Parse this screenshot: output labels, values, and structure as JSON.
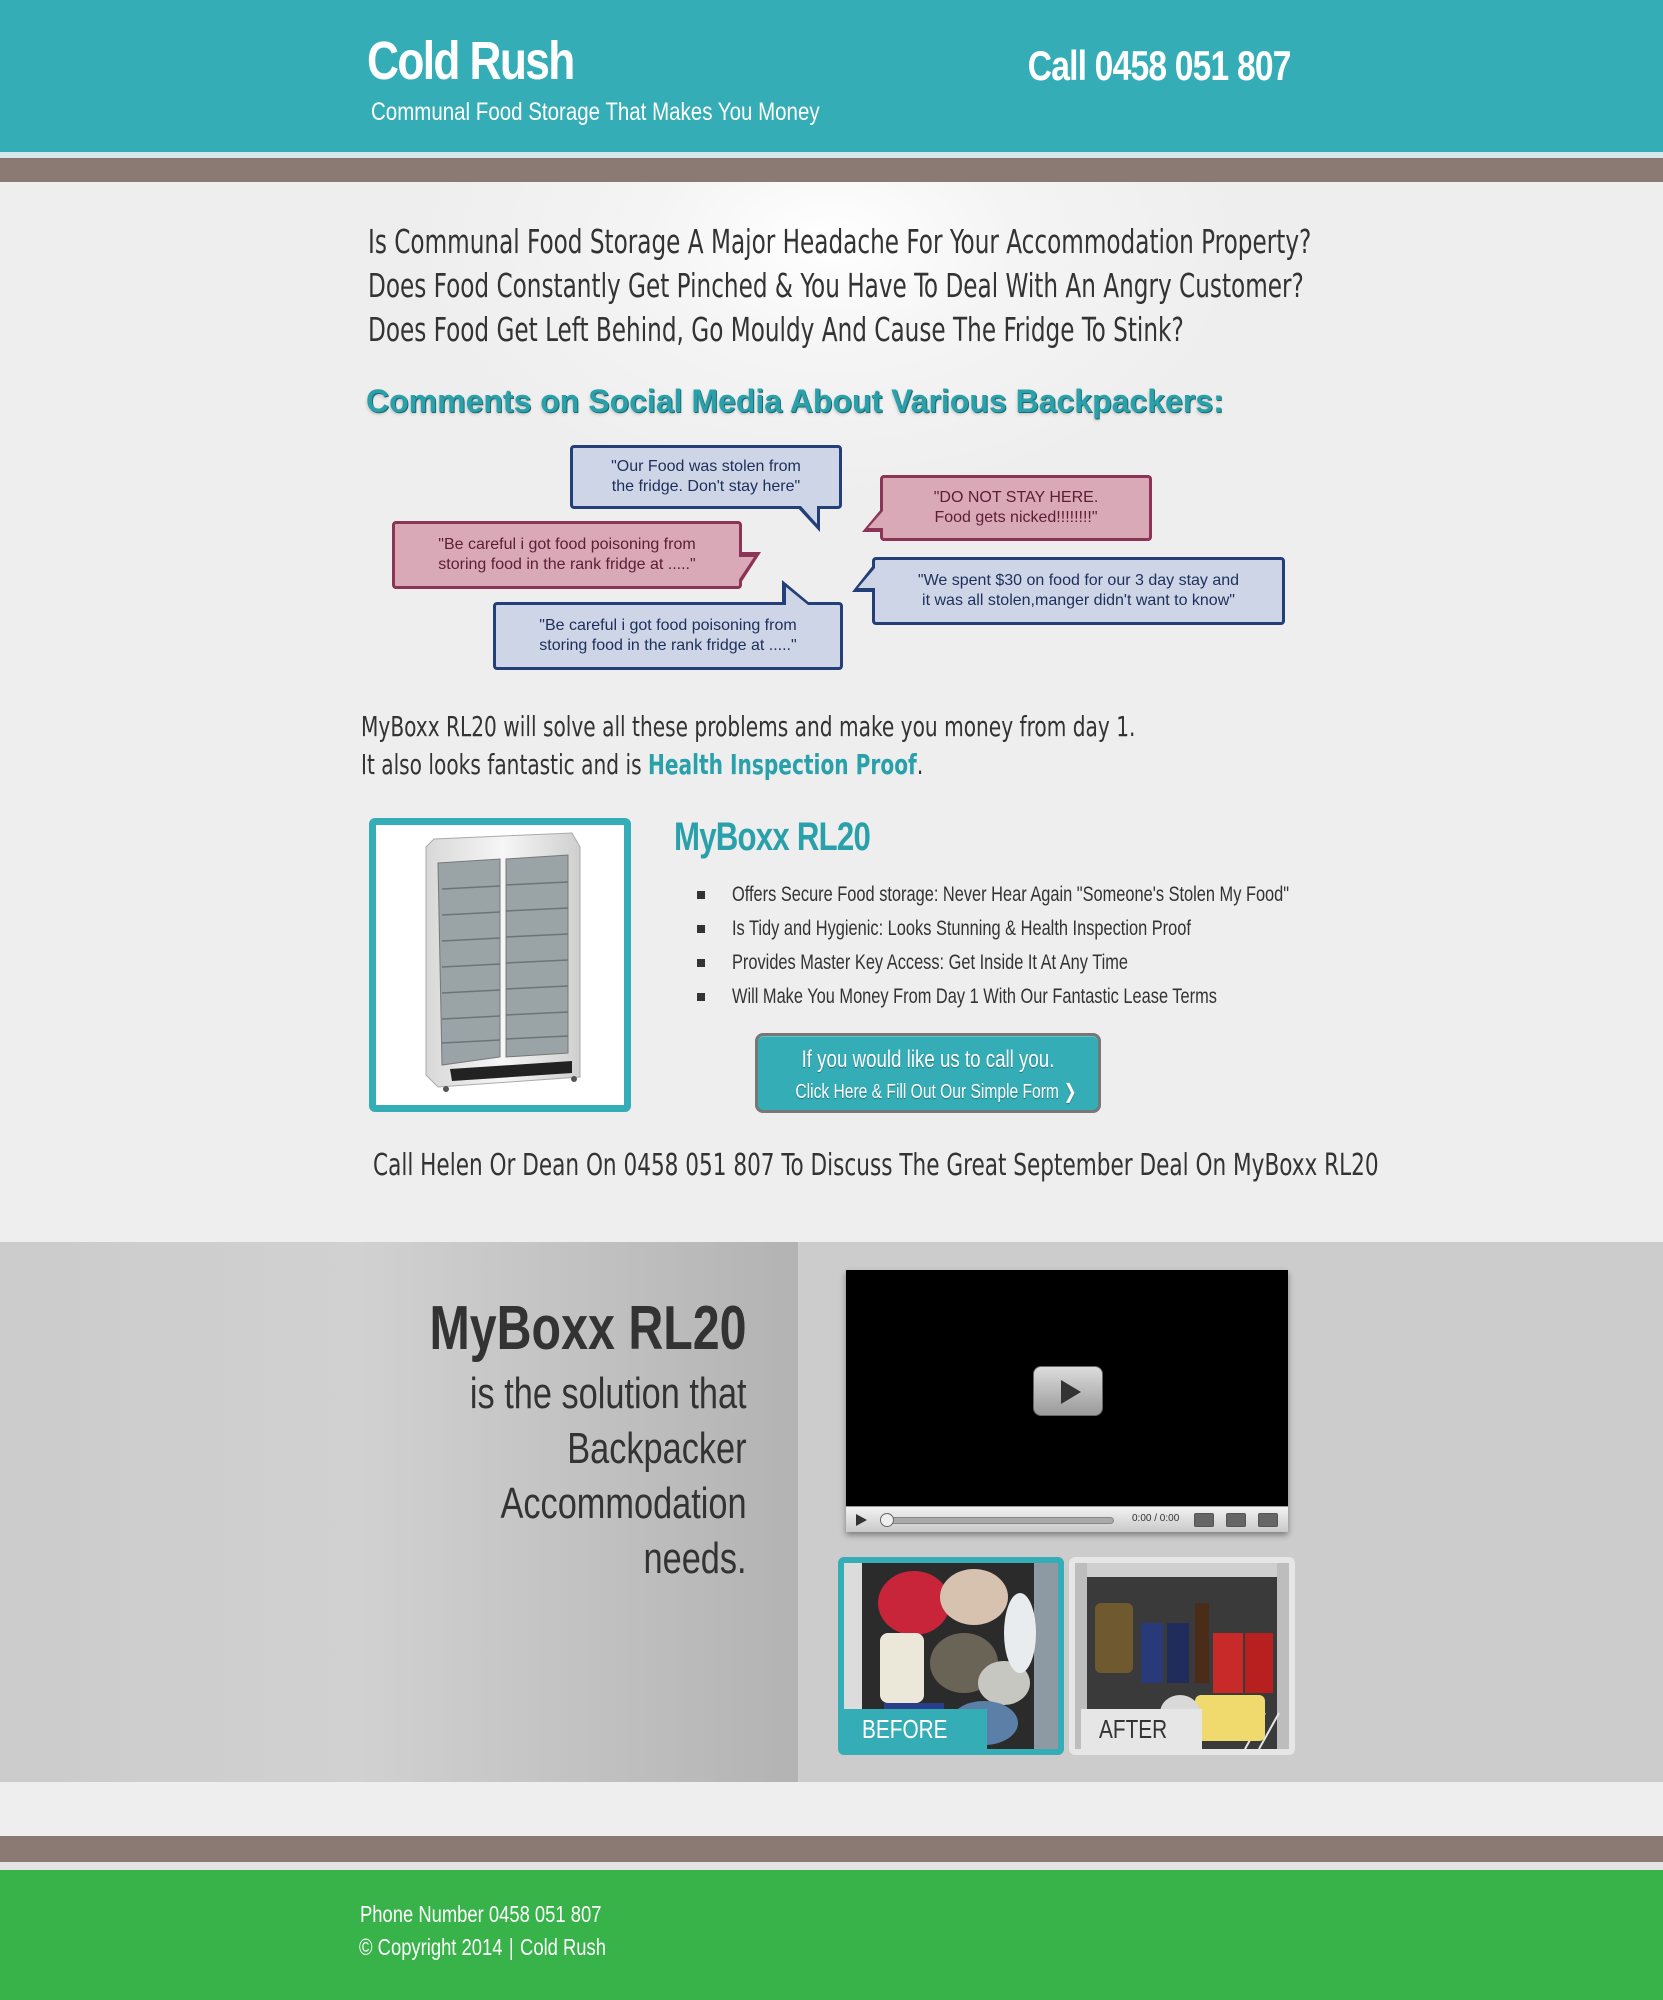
{
  "header": {
    "brand": "Cold Rush",
    "tagline": "Communal Food Storage That Makes You Money",
    "phone": "Call 0458 051 807"
  },
  "questions": [
    "Is Communal Food Storage A Major Headache For Your Accommodation Property?",
    "Does Food Constantly Get Pinched & You Have To Deal With An Angry Customer?",
    "Does Food Get Left Behind, Go Mouldy And Cause The Fridge To Stink?"
  ],
  "comments": {
    "title": "Comments on Social Media About Various Backpackers:",
    "bubbles": [
      {
        "line1": "\"Our Food was stolen from",
        "line2": "the fridge. Don't stay here\"",
        "color": "#cdd5e6"
      },
      {
        "line1": "\"DO NOT STAY HERE.",
        "line2": "Food gets nicked!!!!!!!!\"",
        "color": "#d9a9b8"
      },
      {
        "line1": "\"Be careful i got food poisoning from",
        "line2": "storing food in the rank fridge at .....\"",
        "color": "#d9a9b8"
      },
      {
        "line1": "\"We spent $30 on food for our 3 day stay and",
        "line2": "it was all stolen,manger didn't want to know\"",
        "color": "#cdd5e6"
      },
      {
        "line1": "\"Be careful i got food poisoning from",
        "line2": "storing food in the rank fridge at .....\"",
        "color": "#cdd5e6"
      }
    ]
  },
  "solve": {
    "line1": "MyBoxx RL20 will solve all these problems and make you money from day 1.",
    "line2_prefix": "It also looks fantastic and is ",
    "line2_link": "Health Inspection Proof",
    "line2_suffix": "."
  },
  "product": {
    "title": "MyBoxx RL20",
    "bullets": [
      "Offers Secure Food storage: Never Hear Again \"Someone's Stolen My Food\"",
      "Is Tidy and Hygienic: Looks Stunning & Health Inspection Proof",
      "Provides Master Key Access: Get Inside It At Any Time",
      "Will Make You Money From Day 1 With Our Fantastic Lease Terms"
    ],
    "cta_line1": "If you would like us to call you.",
    "cta_line2": "Click Here & Fill Out Our Simple Form"
  },
  "call_line": "Call Helen Or Dean On 0458 051 807 To Discuss The Great September Deal On MyBoxx RL20",
  "solution": {
    "title": "MyBoxx RL20",
    "lines": [
      "is the solution that",
      "Backpacker",
      "Accommodation",
      "needs."
    ]
  },
  "video": {
    "time": "0:00 / 0:00"
  },
  "photos": {
    "before_label": "BEFORE",
    "after_label": "AFTER"
  },
  "footer": {
    "phone": "Phone Number 0458 051 807",
    "copyright": "© Copyright 2014",
    "company": "Cold Rush"
  },
  "colors": {
    "teal": "#35adb6",
    "taupe": "#8a7a73",
    "green": "#37b34a"
  }
}
